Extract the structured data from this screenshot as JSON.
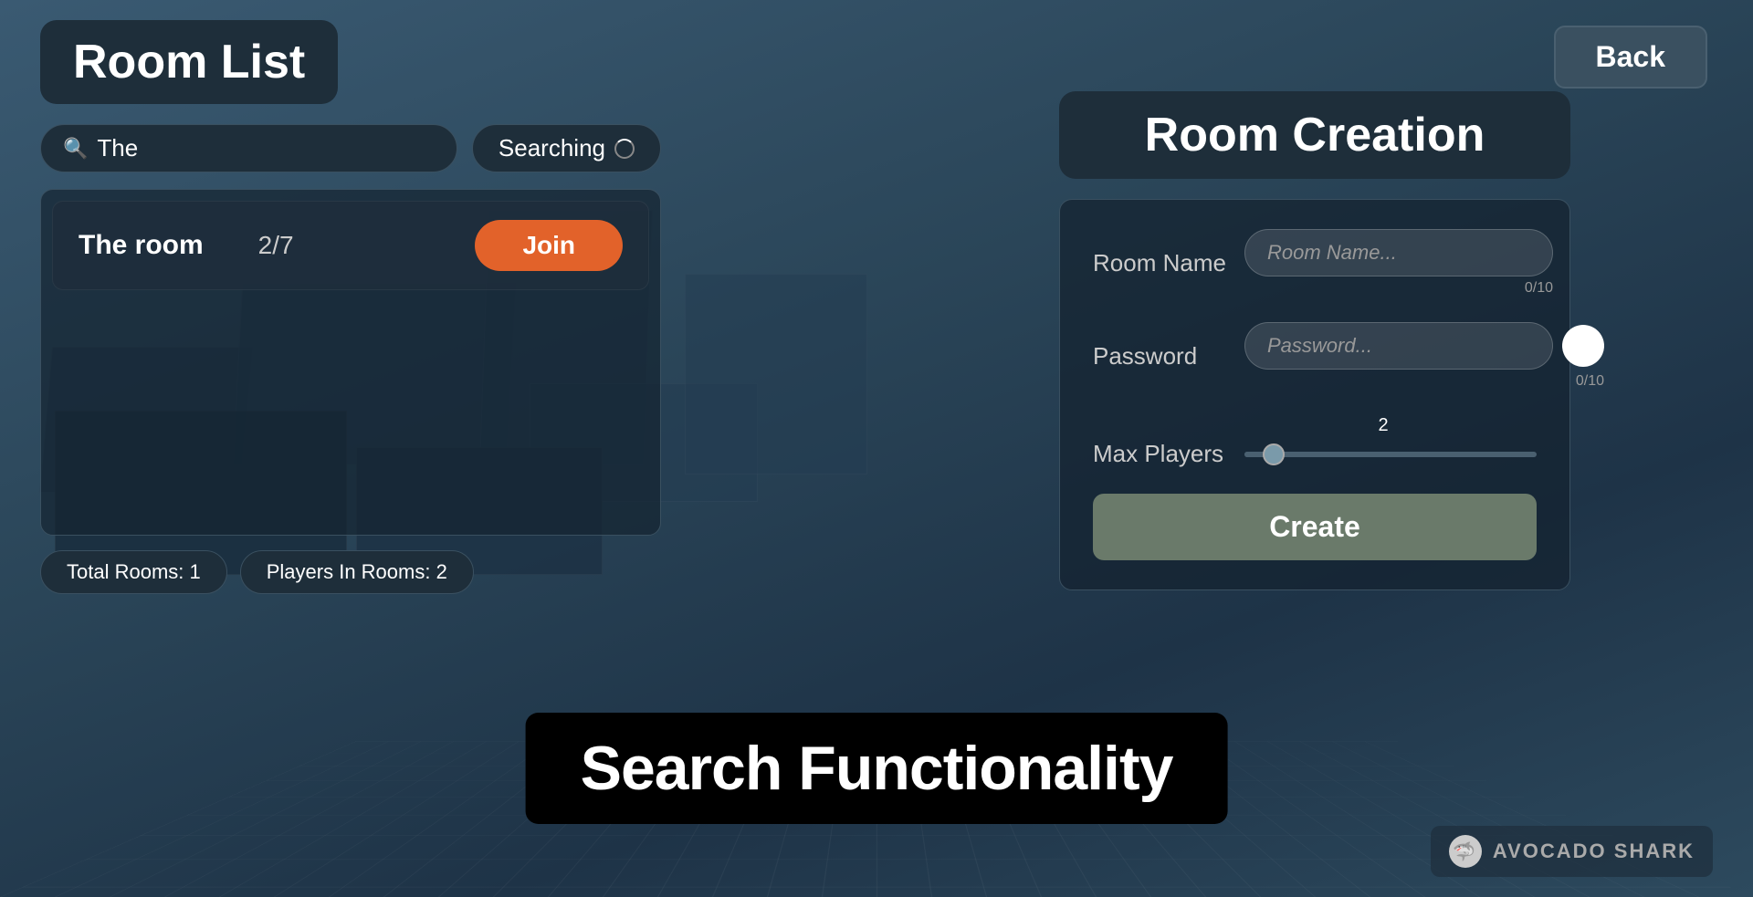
{
  "background": {
    "color": "#2d4a5e"
  },
  "back_button": {
    "label": "Back"
  },
  "room_list": {
    "title": "Room List",
    "search": {
      "value": "The",
      "placeholder": "The",
      "icon": "🔍"
    },
    "searching_label": "Searching",
    "rooms": [
      {
        "name": "The room",
        "players": "2/7",
        "join_label": "Join"
      }
    ],
    "stats": {
      "total_rooms_label": "Total Rooms: 1",
      "players_in_rooms_label": "Players In Rooms: 2"
    }
  },
  "room_creation": {
    "title": "Room Creation",
    "room_name_label": "Room Name",
    "room_name_placeholder": "Room Name...",
    "room_name_char_count": "0/10",
    "password_label": "Password",
    "password_placeholder": "Password...",
    "password_char_count": "0/10",
    "max_players_label": "Max Players",
    "max_players_value": "2",
    "create_label": "Create"
  },
  "bottom_banner": {
    "text": "Search Functionality"
  },
  "logo": {
    "text": "AVOCADO SHARK"
  }
}
